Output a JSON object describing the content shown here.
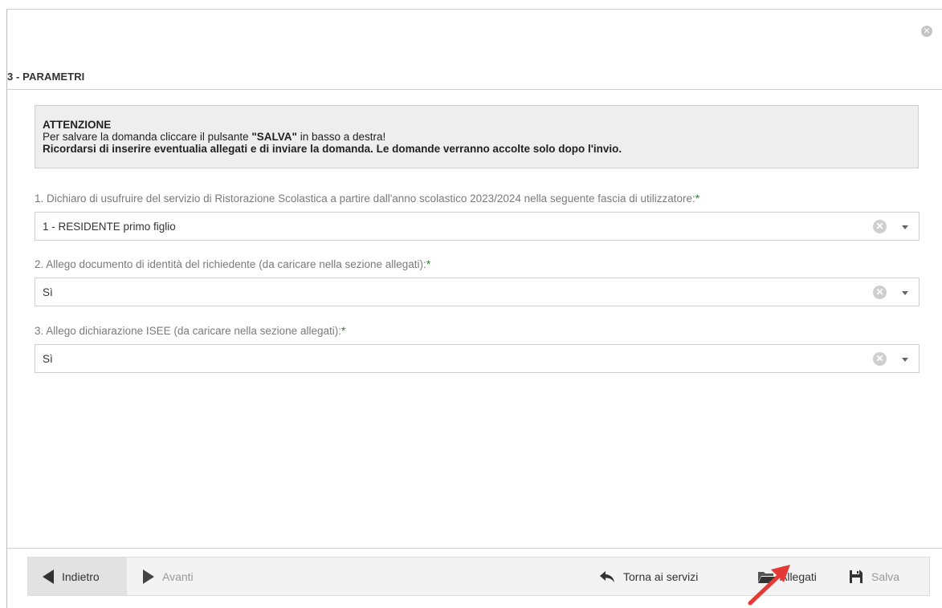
{
  "dialog": {
    "close_icon": "close-circle-icon",
    "section_title": "3 - PARAMETRI"
  },
  "notice": {
    "heading": "ATTENZIONE",
    "line1_pre": "Per salvare la domanda cliccare il pulsante ",
    "line1_bold": "\"SALVA\"",
    "line1_post": " in basso a destra!",
    "line2": "Ricordarsi di inserire eventualia allegati e di inviare la domanda. Le domande verranno accolte solo dopo l'invio."
  },
  "questions": [
    {
      "label": "1. Dichiaro di usufruire del servizio di Ristorazione Scolastica a partire dall'anno scolastico 2023/2024 nella seguente fascia di utilizzatore:",
      "required_mark": "*",
      "value": "1 - RESIDENTE primo figlio"
    },
    {
      "label": "2. Allego documento di identità del richiedente (da caricare nella sezione allegati):",
      "required_mark": "*",
      "value": "Sì"
    },
    {
      "label": "3. Allego dichiarazione ISEE (da caricare nella sezione allegati):",
      "required_mark": "*",
      "value": "Sì"
    }
  ],
  "toolbar": {
    "back_label": "Indietro",
    "next_label": "Avanti",
    "home_label": "Torna ai servizi",
    "attach_label": "Allegati",
    "save_label": "Salva"
  },
  "colors": {
    "accent_required": "#2e7d32",
    "annotation_arrow": "#e53935"
  }
}
